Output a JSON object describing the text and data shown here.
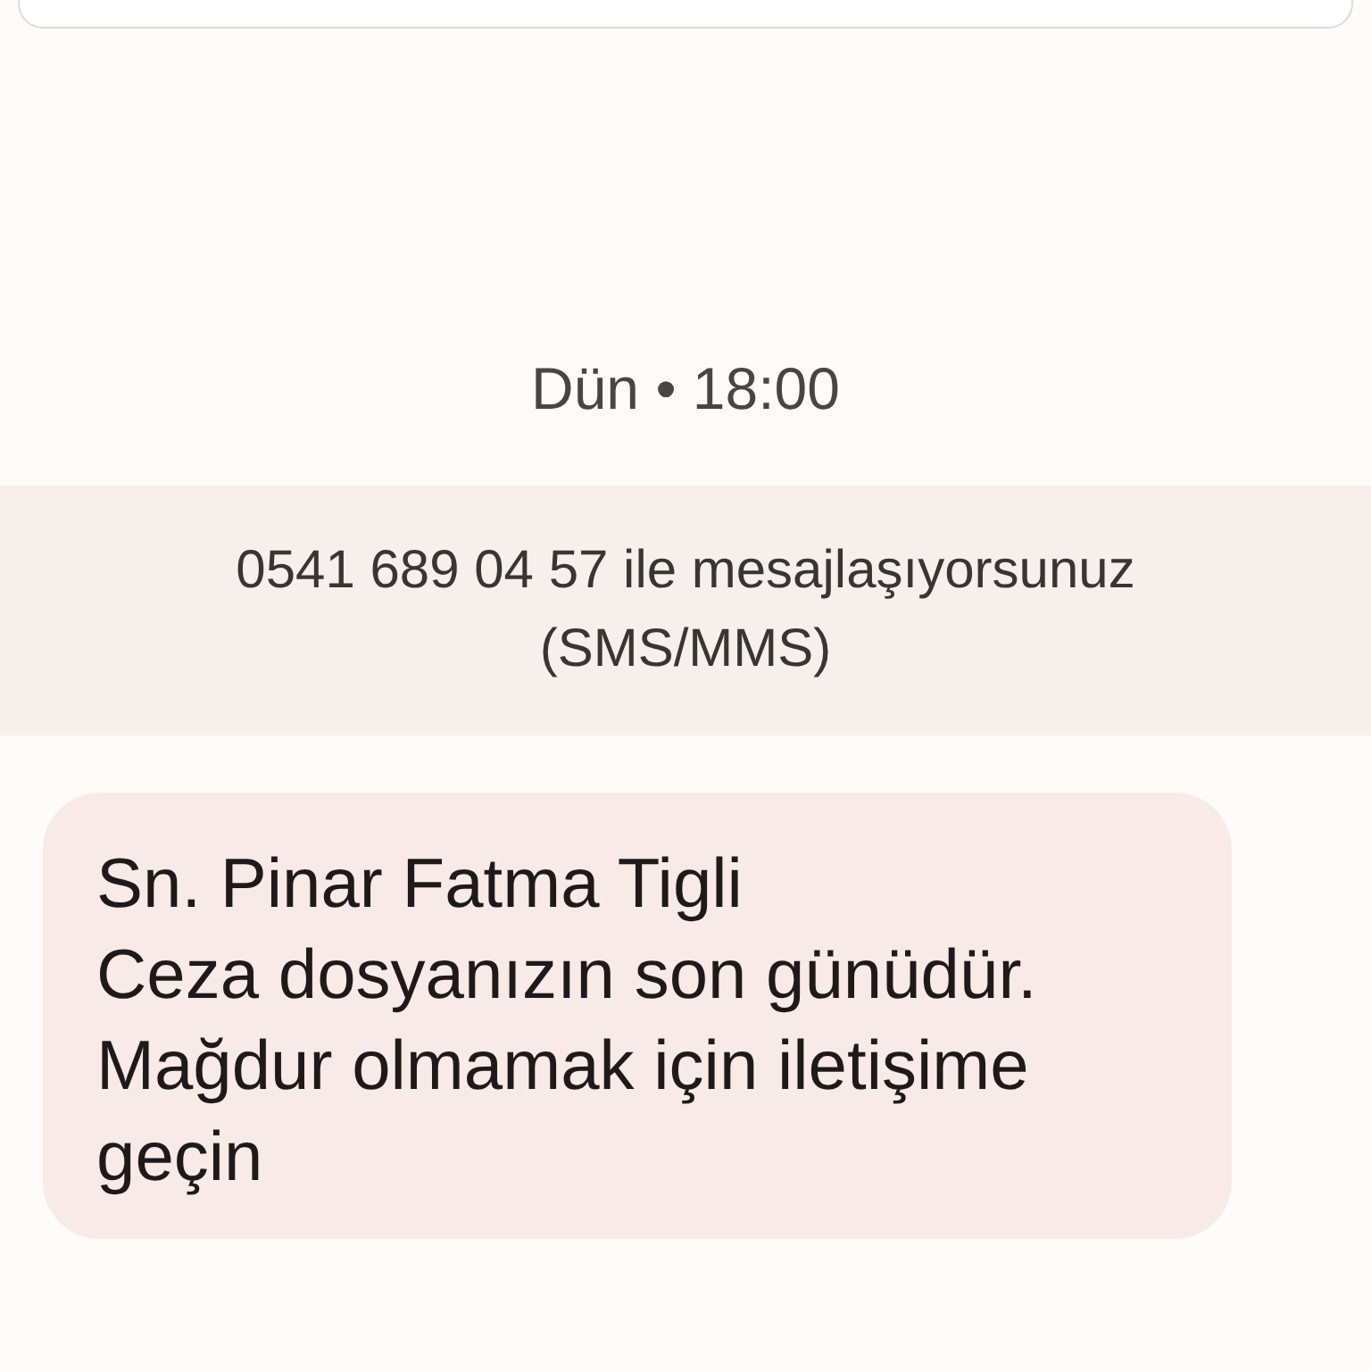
{
  "timestamp": "Dün • 18:00",
  "conversation_banner": "0541 689 04 57 ile mesajlaşıyorsunuz (SMS/MMS)",
  "messages": [
    {
      "text": "Sn. Pinar Fatma Tigli\nCeza dosyanızın son günüdür. Mağdur olmamak için iletişime geçin"
    }
  ]
}
